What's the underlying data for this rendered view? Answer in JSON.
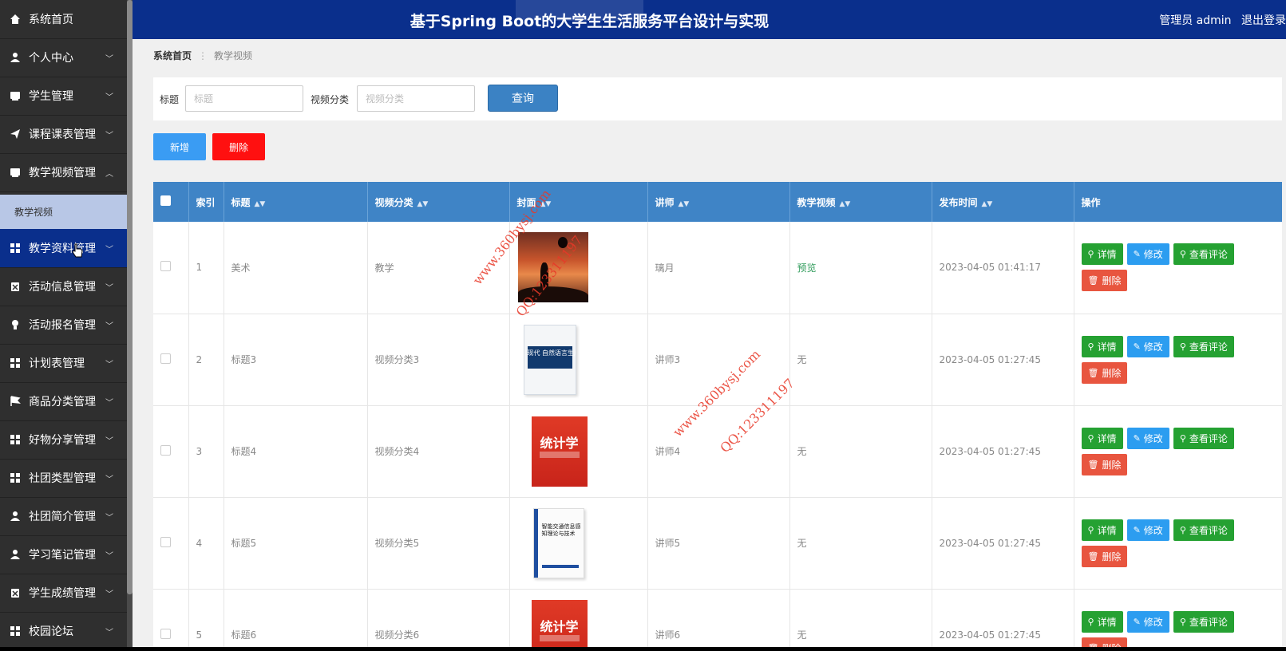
{
  "sidebar": {
    "items": [
      {
        "label": "系统首页",
        "icon": "home-icon",
        "chevron": ""
      },
      {
        "label": "个人中心",
        "icon": "user-icon",
        "chevron": "﹀"
      },
      {
        "label": "学生管理",
        "icon": "card-icon",
        "chevron": "﹀"
      },
      {
        "label": "课程课表管理",
        "icon": "send-icon",
        "chevron": "﹀"
      },
      {
        "label": "教学视频管理",
        "icon": "card-icon",
        "chevron": "︿"
      },
      {
        "label": "教学资料管理",
        "icon": "grid-icon",
        "chevron": "﹀"
      },
      {
        "label": "活动信息管理",
        "icon": "clipboard-icon",
        "chevron": "﹀"
      },
      {
        "label": "活动报名管理",
        "icon": "bulb-icon",
        "chevron": "﹀"
      },
      {
        "label": "计划表管理",
        "icon": "grid-icon",
        "chevron": "﹀"
      },
      {
        "label": "商品分类管理",
        "icon": "flag-icon",
        "chevron": "﹀"
      },
      {
        "label": "好物分享管理",
        "icon": "grid-icon",
        "chevron": "﹀"
      },
      {
        "label": "社团类型管理",
        "icon": "grid-icon",
        "chevron": "﹀"
      },
      {
        "label": "社团简介管理",
        "icon": "user-icon",
        "chevron": "﹀"
      },
      {
        "label": "学习笔记管理",
        "icon": "user-icon",
        "chevron": "﹀"
      },
      {
        "label": "学生成绩管理",
        "icon": "clipboard-icon",
        "chevron": "﹀"
      },
      {
        "label": "校园论坛",
        "icon": "grid-icon",
        "chevron": "﹀"
      }
    ],
    "submenu": {
      "label": "教学视频"
    }
  },
  "header": {
    "title": "基于Spring Boot的大学生生活服务平台设计与实现",
    "user": "管理员 admin",
    "logout": "退出登录"
  },
  "breadcrumb": {
    "home": "系统首页",
    "sep": "⋮",
    "current": "教学视频"
  },
  "search": {
    "title_label": "标题",
    "title_placeholder": "标题",
    "category_label": "视频分类",
    "category_placeholder": "视频分类",
    "query_button": "查询"
  },
  "actions": {
    "add": "新增",
    "delete": "删除"
  },
  "table": {
    "headers": {
      "index": "索引",
      "title": "标题",
      "category": "视频分类",
      "cover": "封面",
      "teacher": "讲师",
      "video": "教学视频",
      "time": "发布时间",
      "ops": "操作"
    },
    "sort_icon": "▲▼",
    "rows": [
      {
        "index": "1",
        "title": "美术",
        "category": "教学",
        "teacher": "璃月",
        "video": "预览",
        "time": "2023-04-05 01:41:17",
        "cover": "sunset"
      },
      {
        "index": "2",
        "title": "标题3",
        "category": "视频分类3",
        "teacher": "讲师3",
        "video": "无",
        "time": "2023-04-05 01:27:45",
        "cover": "book-blue"
      },
      {
        "index": "3",
        "title": "标题4",
        "category": "视频分类4",
        "teacher": "讲师4",
        "video": "无",
        "time": "2023-04-05 01:27:45",
        "cover": "book-red"
      },
      {
        "index": "4",
        "title": "标题5",
        "category": "视频分类5",
        "teacher": "讲师5",
        "video": "无",
        "time": "2023-04-05 01:27:45",
        "cover": "book-white"
      },
      {
        "index": "5",
        "title": "标题6",
        "category": "视频分类6",
        "teacher": "讲师6",
        "video": "无",
        "time": "2023-04-05 01:27:45",
        "cover": "book-red"
      }
    ],
    "op_labels": {
      "detail": "详情",
      "edit": "修改",
      "review": "查看评论",
      "remove": "删除"
    },
    "cover_text": {
      "blue": "现代 自然语言生成",
      "red": "统计学",
      "white": "智能交通信息感知理论与技术"
    }
  },
  "watermarks": [
    "www.360bysj.com",
    "QQ:123311197",
    "www.360bysj.com",
    "QQ:123311197"
  ],
  "colors": {
    "header": "#0a2f8c",
    "sidebar": "#2f2f2f",
    "table_header": "#3f84c6",
    "success": "#25a132",
    "primary": "#2c9df0",
    "danger": "#e8553f"
  }
}
